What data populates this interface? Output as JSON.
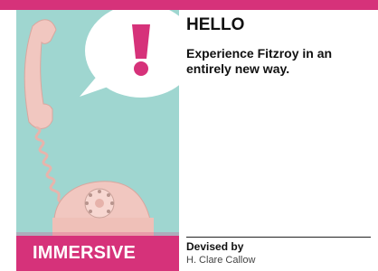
{
  "card": {
    "headline": "HELLO",
    "blurb": "Experience Fitzroy in an entirely new way.",
    "category": "IMMERSIVE",
    "credit_label": "Devised by",
    "credit_name": "H. Clare Callow"
  },
  "image": {
    "subject": "pink telephone with speech bubble",
    "icon": "exclamation-icon"
  },
  "colors": {
    "accent": "#d6327a",
    "photo_background": "#9fd6d0",
    "phone": "#f1c7c0"
  }
}
